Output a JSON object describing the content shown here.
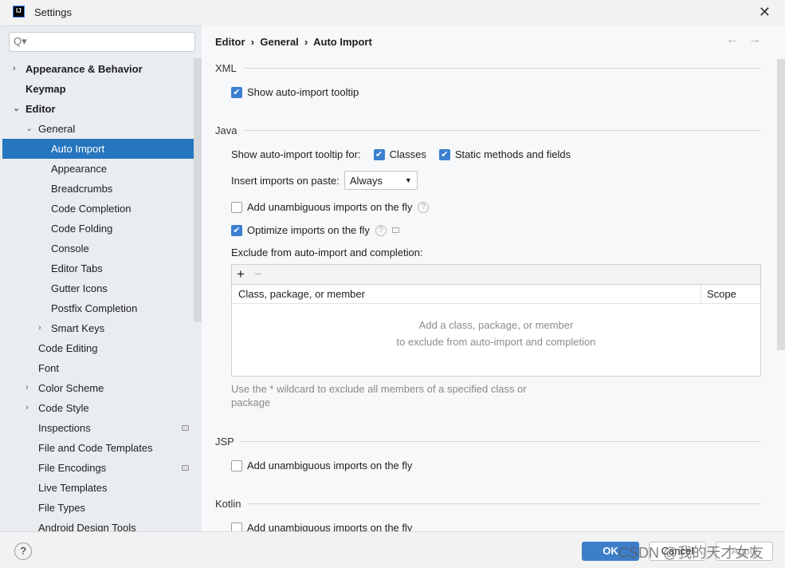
{
  "window": {
    "title": "Settings",
    "logo": "IJ"
  },
  "search": {
    "placeholder": "Q▾"
  },
  "tree": [
    {
      "label": "Appearance & Behavior",
      "level": 0,
      "bold": true,
      "arrow": "›"
    },
    {
      "label": "Keymap",
      "level": 0,
      "bold": true
    },
    {
      "label": "Editor",
      "level": 0,
      "bold": true,
      "arrow": "⌄"
    },
    {
      "label": "General",
      "level": 1,
      "arrow": "⌄"
    },
    {
      "label": "Auto Import",
      "level": 2,
      "selected": true
    },
    {
      "label": "Appearance",
      "level": 2
    },
    {
      "label": "Breadcrumbs",
      "level": 2
    },
    {
      "label": "Code Completion",
      "level": 2
    },
    {
      "label": "Code Folding",
      "level": 2
    },
    {
      "label": "Console",
      "level": 2
    },
    {
      "label": "Editor Tabs",
      "level": 2
    },
    {
      "label": "Gutter Icons",
      "level": 2
    },
    {
      "label": "Postfix Completion",
      "level": 2
    },
    {
      "label": "Smart Keys",
      "level": 2,
      "arrow": "›"
    },
    {
      "label": "Code Editing",
      "level": 1
    },
    {
      "label": "Font",
      "level": 1
    },
    {
      "label": "Color Scheme",
      "level": 1,
      "arrow": "›"
    },
    {
      "label": "Code Style",
      "level": 1,
      "arrow": "›"
    },
    {
      "label": "Inspections",
      "level": 1,
      "badge": true
    },
    {
      "label": "File and Code Templates",
      "level": 1
    },
    {
      "label": "File Encodings",
      "level": 1,
      "badge": true
    },
    {
      "label": "Live Templates",
      "level": 1
    },
    {
      "label": "File Types",
      "level": 1
    },
    {
      "label": "Android Design Tools",
      "level": 1
    }
  ],
  "breadcrumb": {
    "a": "Editor",
    "b": "General",
    "c": "Auto Import",
    "sep": "›"
  },
  "nav": {
    "back": "←",
    "forward": "→"
  },
  "xml": {
    "title": "XML",
    "tooltip": "Show auto-import tooltip"
  },
  "java": {
    "title": "Java",
    "tooltip_for": "Show auto-import tooltip for:",
    "classes": "Classes",
    "static": "Static methods and fields",
    "insert_label": "Insert imports on paste:",
    "insert_value": "Always",
    "unambiguous": "Add unambiguous imports on the fly",
    "optimize": "Optimize imports on the fly",
    "exclude": "Exclude from auto-import and completion:",
    "add": "+",
    "remove": "−",
    "col1": "Class, package, or member",
    "col2": "Scope",
    "empty1": "Add a class, package, or member",
    "empty2": "to exclude from auto-import and completion",
    "hint": "Use the * wildcard to exclude all members of a specified class or package"
  },
  "jsp": {
    "title": "JSP",
    "unambiguous": "Add unambiguous imports on the fly"
  },
  "kotlin": {
    "title": "Kotlin",
    "unambiguous": "Add unambiguous imports on the fly"
  },
  "footer": {
    "help": "?",
    "ok": "OK",
    "cancel": "Cancel",
    "apply": "Apply",
    "watermark": "CSDN @我的天才女友"
  },
  "colors": {
    "accent": "#2675bf",
    "checkbox": "#3c7fd1"
  }
}
